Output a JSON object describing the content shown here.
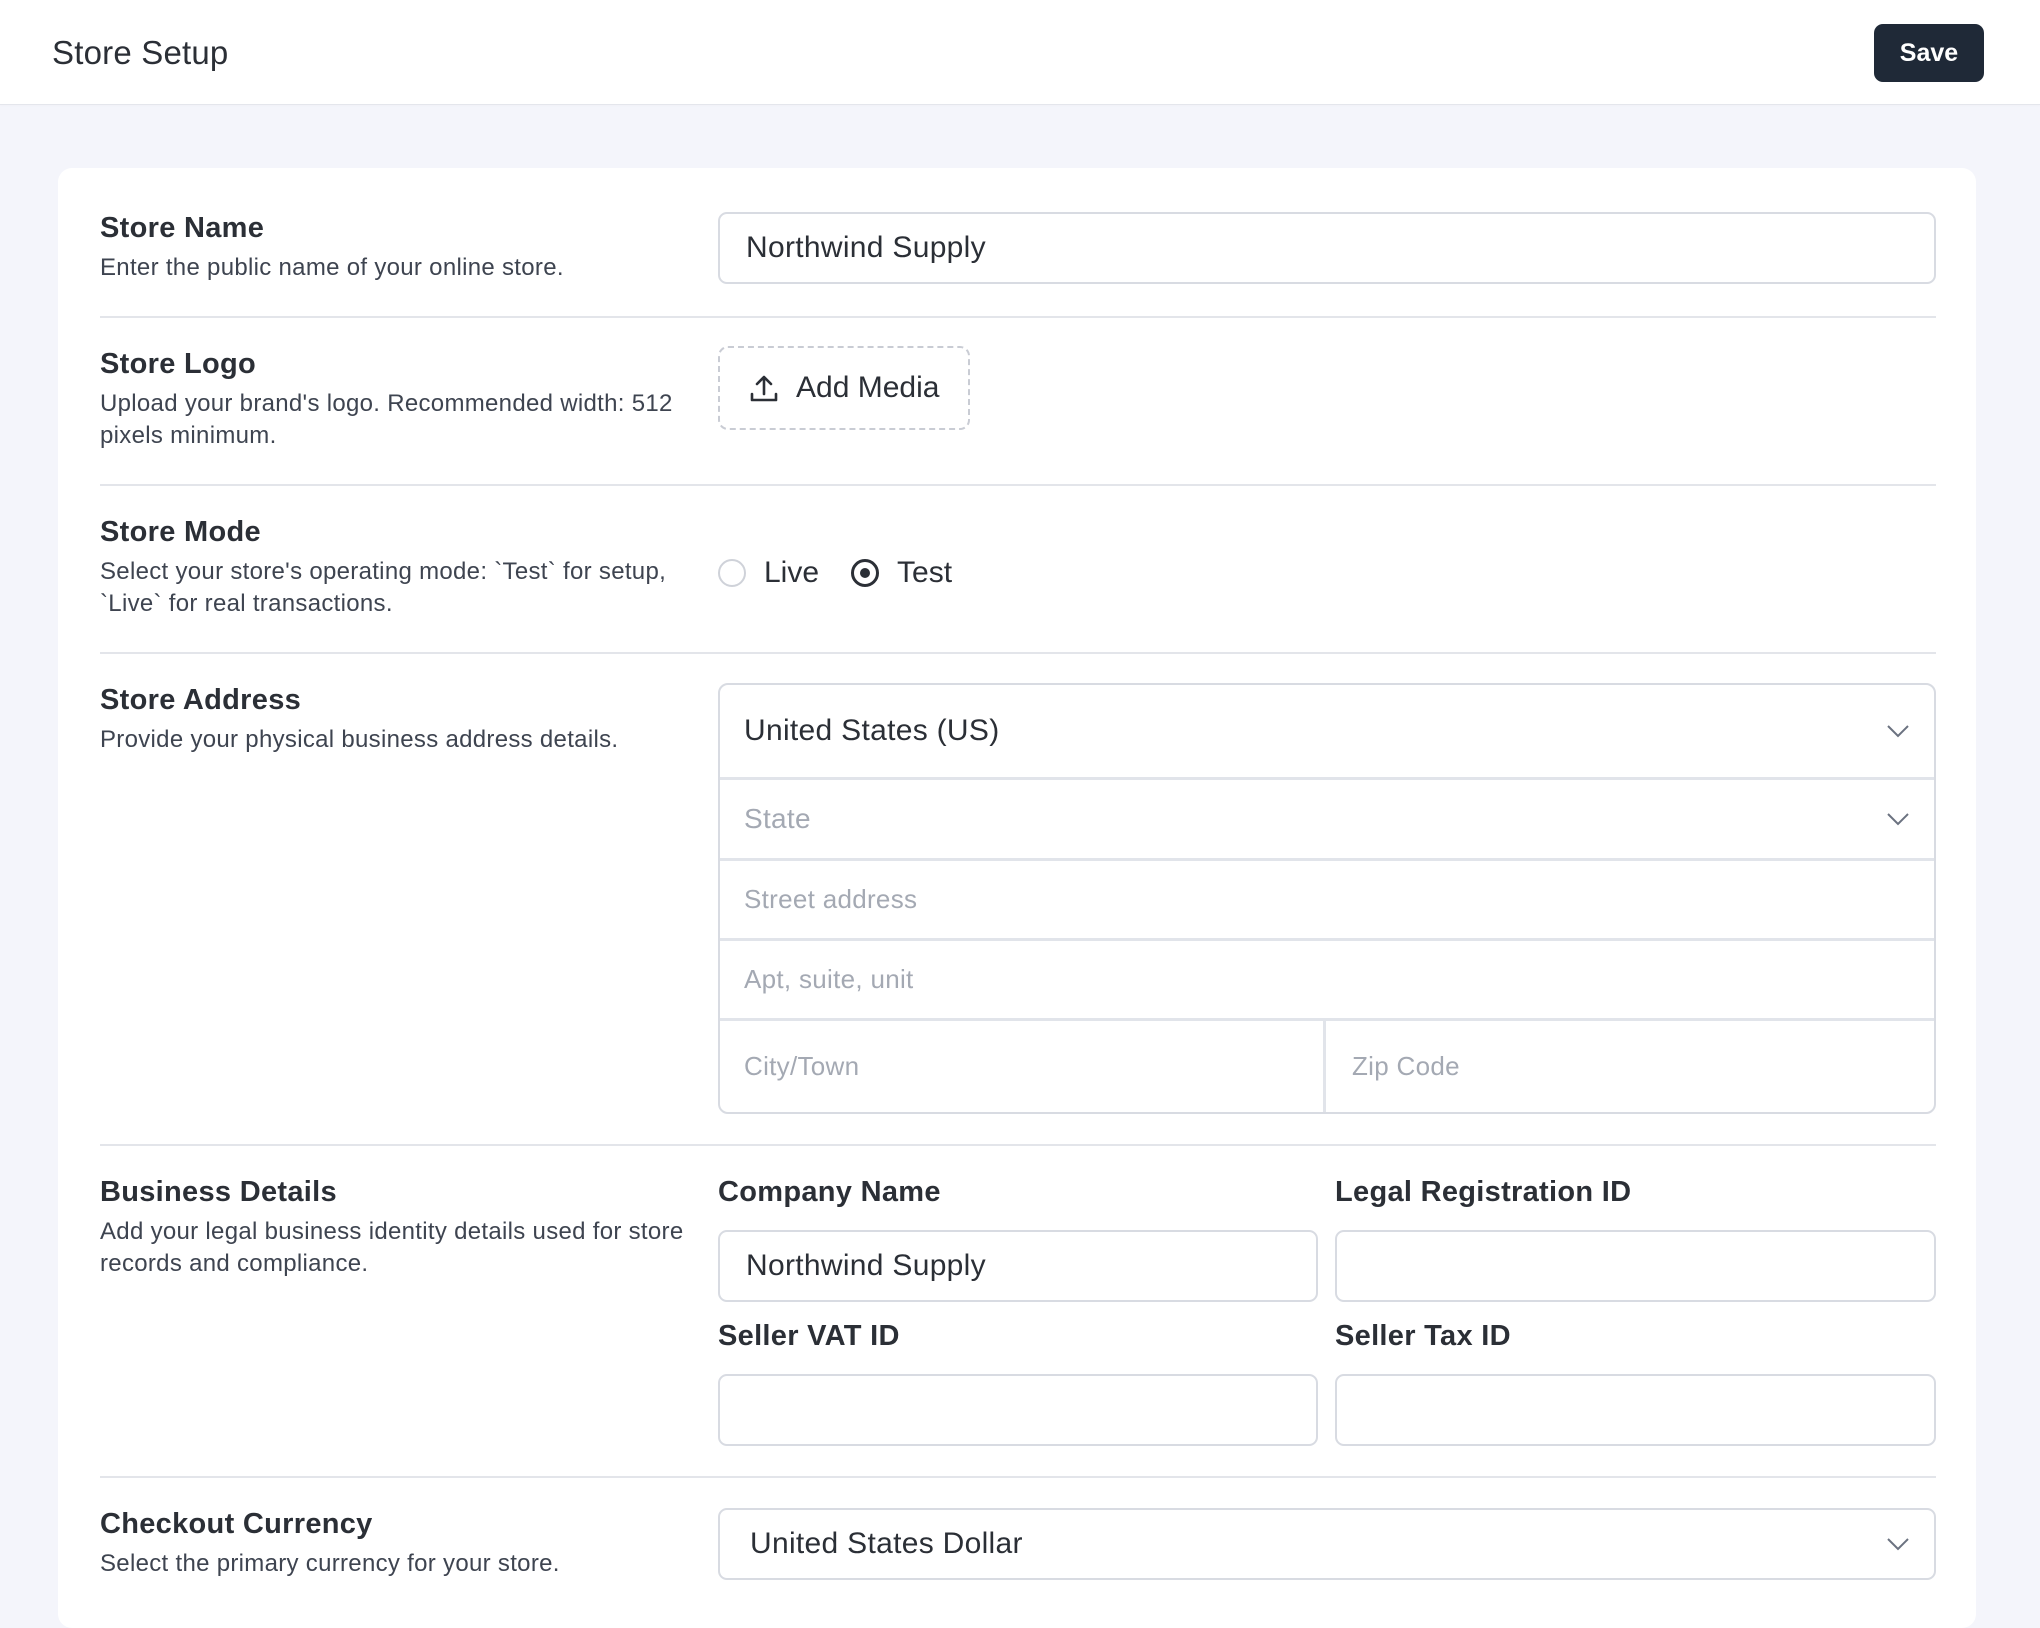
{
  "header": {
    "title": "Store Setup",
    "save_label": "Save"
  },
  "sections": {
    "store_name": {
      "title": "Store Name",
      "description": "Enter the public name of your online store.",
      "value": "Northwind Supply"
    },
    "store_logo": {
      "title": "Store Logo",
      "description": "Upload your brand's logo. Recommended width: 512 pixels minimum.",
      "button_label": "Add Media",
      "button_icon": "upload-icon"
    },
    "store_mode": {
      "title": "Store Mode",
      "description": "Select your store's operating mode: `Test` for setup, `Live` for real transactions.",
      "options": [
        {
          "label": "Live",
          "checked": false
        },
        {
          "label": "Test",
          "checked": true
        }
      ]
    },
    "store_address": {
      "title": "Store Address",
      "description": "Provide your physical business address details.",
      "country": "United States (US)",
      "state_placeholder": "State",
      "street_placeholder": "Street address",
      "apt_placeholder": "Apt, suite, unit",
      "city_placeholder": "City/Town",
      "zip_placeholder": "Zip Code"
    },
    "business_details": {
      "title": "Business Details",
      "description": "Add your legal business identity details used for store records and compliance.",
      "company_name_label": "Company Name",
      "company_name_value": "Northwind Supply",
      "legal_registration_label": "Legal Registration ID",
      "legal_registration_value": "",
      "seller_vat_label": "Seller VAT ID",
      "seller_vat_value": "",
      "seller_tax_label": "Seller Tax ID",
      "seller_tax_value": ""
    },
    "checkout_currency": {
      "title": "Checkout Currency",
      "description": "Select the primary currency for your store.",
      "value": "United States Dollar"
    }
  },
  "colors": {
    "page_background": "#f4f5fb",
    "card_background": "#ffffff",
    "primary_button": "#1f2937",
    "text": "#2b2f36",
    "muted_text": "#3e4450",
    "placeholder": "#a4a9b3",
    "border": "#d8dbe2"
  }
}
